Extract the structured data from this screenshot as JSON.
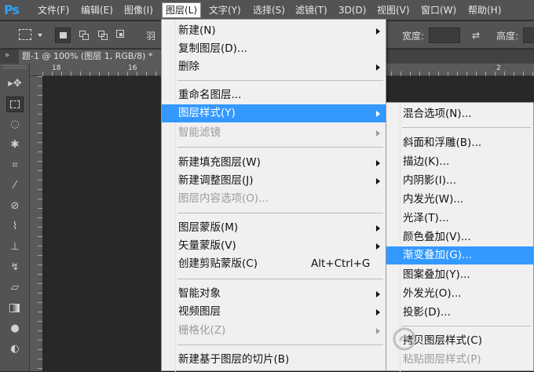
{
  "app": {
    "logo": "Ps"
  },
  "menubar": {
    "items": [
      {
        "label": "文件(F)"
      },
      {
        "label": "编辑(E)"
      },
      {
        "label": "图像(I)"
      },
      {
        "label": "图层(L)"
      },
      {
        "label": "文字(Y)"
      },
      {
        "label": "选择(S)"
      },
      {
        "label": "滤镜(T)"
      },
      {
        "label": "3D(D)"
      },
      {
        "label": "视图(V)"
      },
      {
        "label": "窗口(W)"
      },
      {
        "label": "帮助(H)"
      }
    ],
    "active": "图层(L)"
  },
  "options_bar": {
    "feather_label": "羽",
    "width_label": "宽度:",
    "height_label": "高度:"
  },
  "document_tab": {
    "title": "题-1 @ 100% (图层 1, RGB/8) *"
  },
  "ruler": {
    "marks": [
      "18",
      "16",
      "2"
    ]
  },
  "layer_menu": {
    "items": [
      {
        "label": "新建(N)",
        "submenu": true
      },
      {
        "label": "复制图层(D)..."
      },
      {
        "label": "删除",
        "submenu": true
      },
      {
        "label": "重命名图层..."
      },
      {
        "label": "图层样式(Y)",
        "submenu": true,
        "highlighted": true
      },
      {
        "label": "智能滤镜",
        "submenu": true,
        "disabled": true
      },
      {
        "label": "新建填充图层(W)",
        "submenu": true
      },
      {
        "label": "新建调整图层(J)",
        "submenu": true
      },
      {
        "label": "图层内容选项(O)...",
        "disabled": true
      },
      {
        "label": "图层蒙版(M)",
        "submenu": true
      },
      {
        "label": "矢量蒙版(V)",
        "submenu": true
      },
      {
        "label": "创建剪贴蒙版(C)",
        "shortcut": "Alt+Ctrl+G"
      },
      {
        "label": "智能对象",
        "submenu": true
      },
      {
        "label": "视频图层",
        "submenu": true
      },
      {
        "label": "栅格化(Z)",
        "submenu": true,
        "disabled": true
      },
      {
        "label": "新建基于图层的切片(B)"
      }
    ]
  },
  "style_submenu": {
    "items": [
      {
        "label": "混合选项(N)..."
      },
      {
        "label": "斜面和浮雕(B)..."
      },
      {
        "label": "描边(K)..."
      },
      {
        "label": "内阴影(I)..."
      },
      {
        "label": "内发光(W)..."
      },
      {
        "label": "光泽(T)..."
      },
      {
        "label": "颜色叠加(V)..."
      },
      {
        "label": "渐变叠加(G)...",
        "highlighted": true
      },
      {
        "label": "图案叠加(Y)..."
      },
      {
        "label": "外发光(O)..."
      },
      {
        "label": "投影(D)..."
      },
      {
        "label": "拷贝图层样式(C)"
      },
      {
        "label": "粘贴图层样式(P)",
        "disabled": true
      }
    ]
  },
  "colors": {
    "highlight": "#3399ff",
    "menu_bg": "#f0f0f0",
    "disabled_text": "#9c9c9c",
    "chrome": "#535353"
  }
}
